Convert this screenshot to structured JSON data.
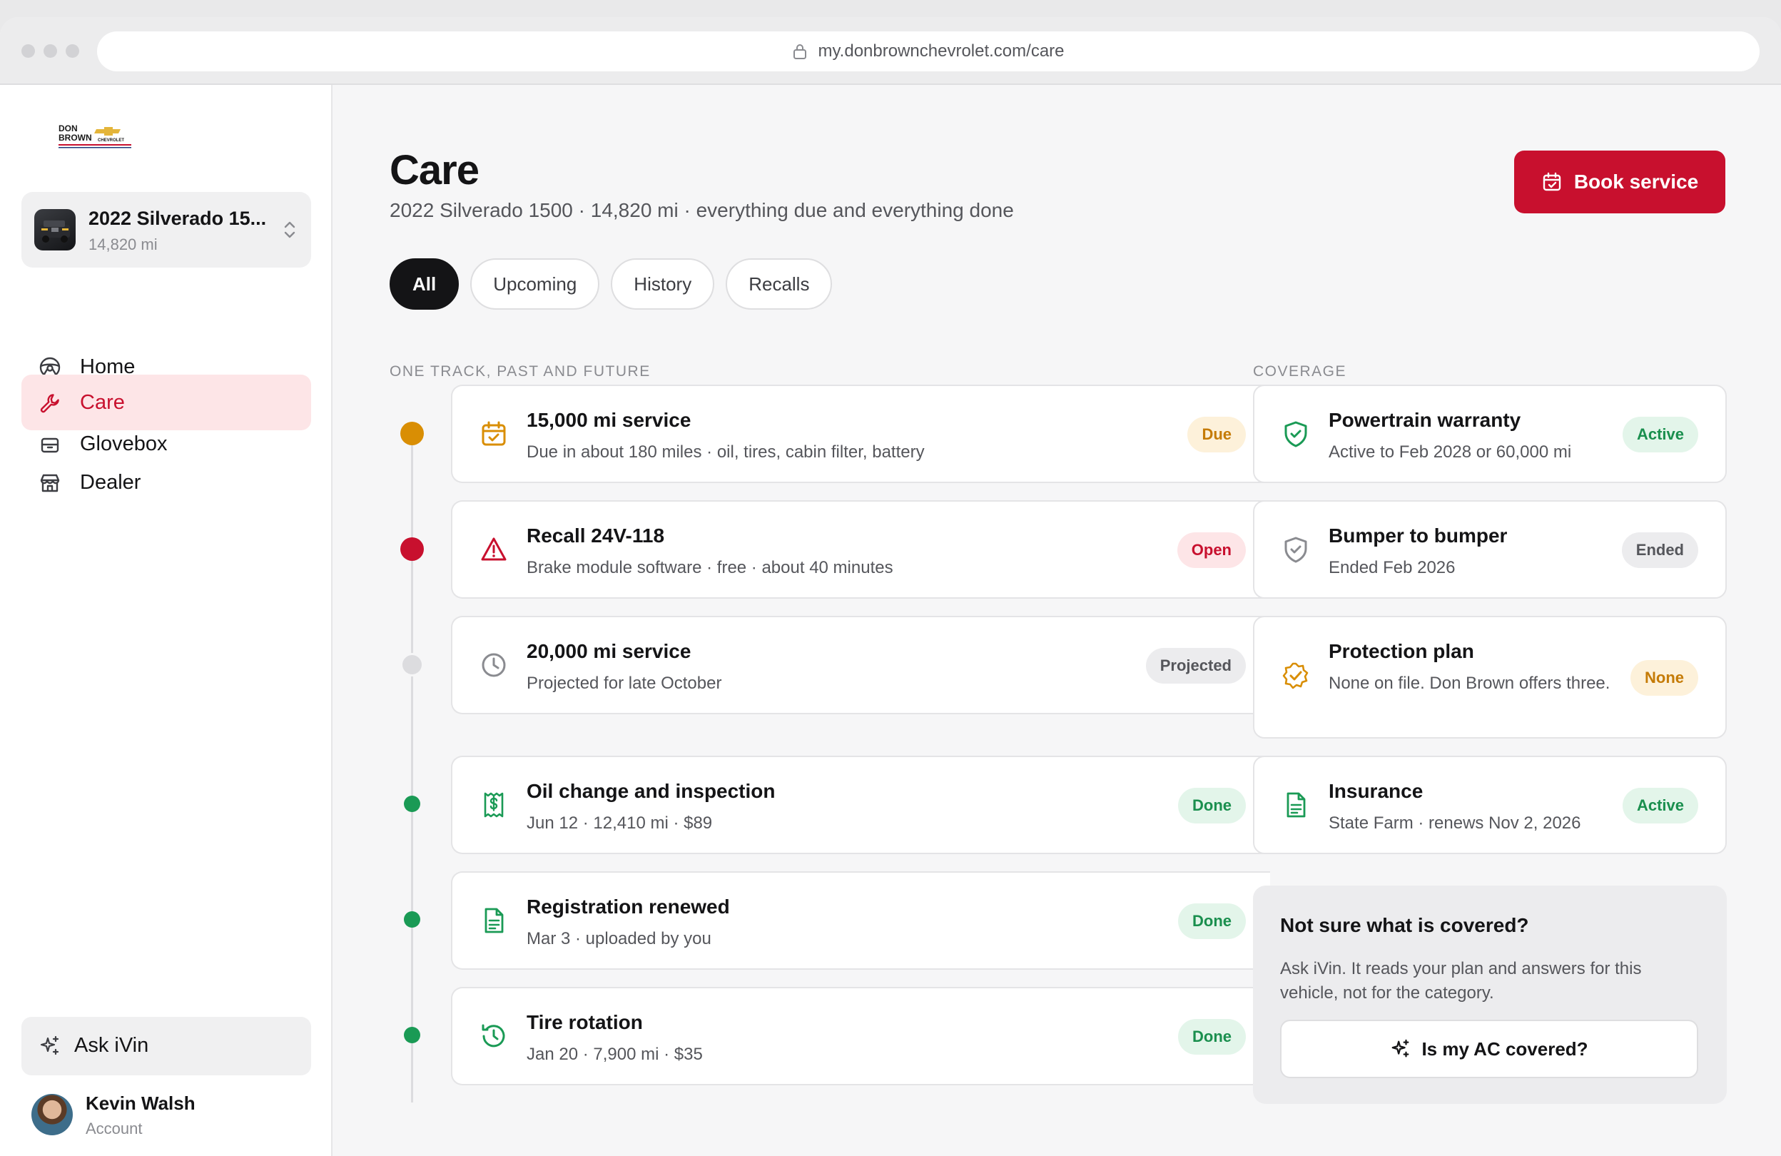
{
  "browser": {
    "url": "my.donbrownchevrolet.com/care"
  },
  "logo": {
    "line1": "DON",
    "line2": "BROWN",
    "line3": "CHEVROLET"
  },
  "vehicle": {
    "name": "2022 Silverado 15...",
    "miles": "14,820 mi"
  },
  "nav": [
    {
      "label": "Home",
      "icon": "steering-wheel-icon"
    },
    {
      "label": "Care",
      "icon": "wrench-icon",
      "active": true
    },
    {
      "label": "Glovebox",
      "icon": "glovebox-icon"
    },
    {
      "label": "Dealer",
      "icon": "storefront-icon"
    }
  ],
  "ask": {
    "label": "Ask iVin"
  },
  "user": {
    "name": "Kevin Walsh",
    "sub": "Account"
  },
  "header": {
    "title": "Care",
    "subtitle": "2022 Silverado 1500 · 14,820 mi · everything due and everything done",
    "book_label": "Book service"
  },
  "tabs": [
    {
      "label": "All",
      "active": true
    },
    {
      "label": "Upcoming"
    },
    {
      "label": "History"
    },
    {
      "label": "Recalls"
    }
  ],
  "track": {
    "label": "ONE TRACK, PAST AND FUTURE",
    "items": [
      {
        "title": "15,000 mi service",
        "sub": "Due in about 180 miles · oil, tires, cabin filter, battery",
        "badge": "Due",
        "icon": "calendar-check-icon",
        "color": "#d98e04"
      },
      {
        "title": "Recall 24V-118",
        "sub": "Brake module software · free · about 40 minutes",
        "badge": "Open",
        "icon": "warning-icon",
        "color": "#c8102e"
      },
      {
        "title": "20,000 mi service",
        "sub": "Projected for late October",
        "badge": "Projected",
        "icon": "clock-icon",
        "color": "#dcdcdf"
      },
      {
        "title": "Oil change and inspection",
        "sub": "Jun 12 · 12,410 mi · $89",
        "badge": "Done",
        "icon": "receipt-icon",
        "color": "#1a9a55"
      },
      {
        "title": "Registration renewed",
        "sub": "Mar 3 · uploaded by you",
        "badge": "Done",
        "icon": "document-icon",
        "color": "#1a9a55"
      },
      {
        "title": "Tire rotation",
        "sub": "Jan 20 · 7,900 mi · $35",
        "badge": "Done",
        "icon": "history-icon",
        "color": "#1a9a55"
      }
    ]
  },
  "coverage": {
    "label": "COVERAGE",
    "items": [
      {
        "title": "Powertrain warranty",
        "sub": "Active to Feb 2028 or 60,000 mi",
        "badge": "Active",
        "icon": "shield-check-icon"
      },
      {
        "title": "Bumper to bumper",
        "sub": "Ended Feb 2026",
        "badge": "Ended",
        "icon": "shield-check-icon"
      },
      {
        "title": "Protection plan",
        "sub": "None on file. Don Brown offers three.",
        "badge": "None",
        "icon": "badge-check-icon"
      },
      {
        "title": "Insurance",
        "sub": "State Farm · renews Nov 2, 2026",
        "badge": "Active",
        "icon": "document-icon"
      }
    ]
  },
  "help": {
    "title": "Not sure what is covered?",
    "body": "Ask iVin. It reads your plan and answers for this vehicle, not for the category.",
    "button": "Is my AC covered?"
  },
  "colors": {
    "accent": "#c8102e",
    "success": "#1a9a55",
    "warning": "#d98e04"
  }
}
